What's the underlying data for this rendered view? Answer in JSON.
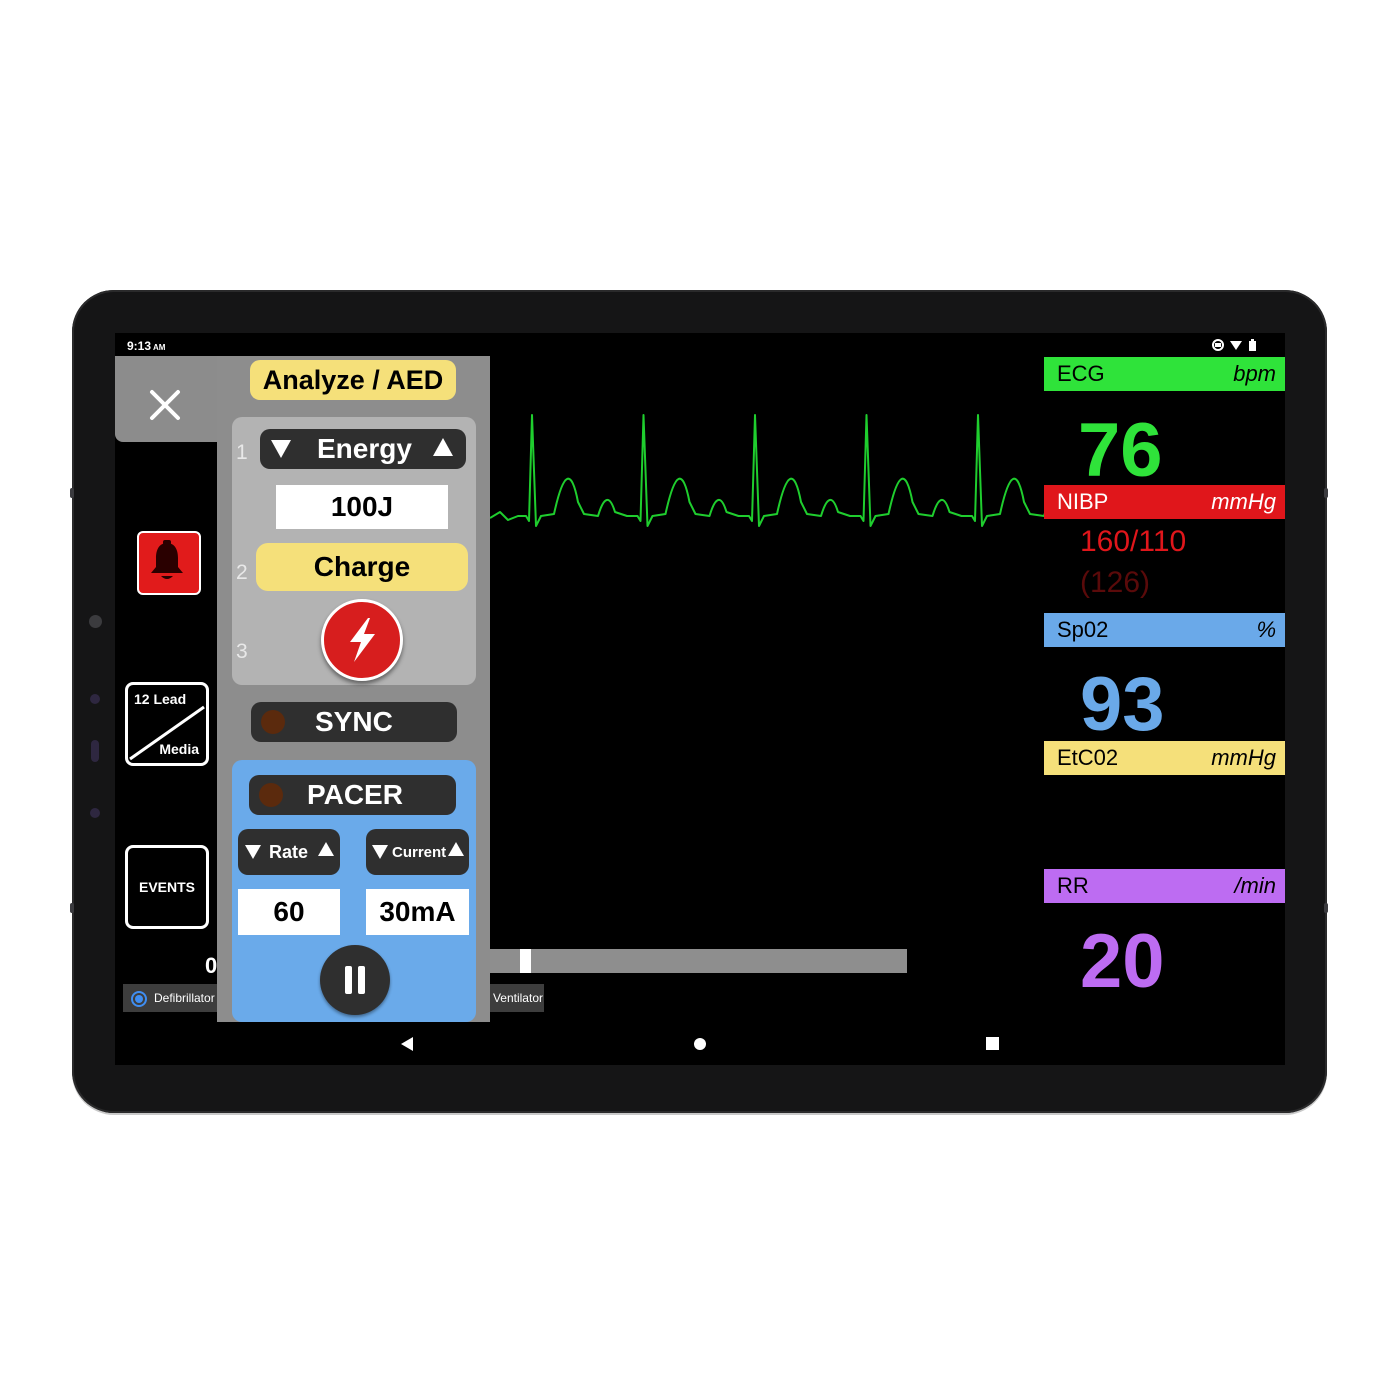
{
  "status": {
    "time": "9:13",
    "ampm": "AM"
  },
  "panel": {
    "analyze_label": "Analyze / AED",
    "step1": "1",
    "step2": "2",
    "step3": "3",
    "energy_label": "Energy",
    "energy_value": "100J",
    "charge_label": "Charge",
    "sync_label": "SYNC",
    "pacer_label": "PACER",
    "rate_label": "Rate",
    "current_label": "Current",
    "rate_value": "60",
    "current_value": "30mA"
  },
  "left_tools": {
    "lead_label": "12 Lead",
    "media_label": "Media",
    "events_label": "EVENTS"
  },
  "bottom": {
    "zero_label": "0",
    "defib_tab": "Defibrillator",
    "vent_tab": "Ventilator",
    "progress": 0.07
  },
  "vitals": {
    "ecg": {
      "label": "ECG",
      "unit": "bpm",
      "value": "76",
      "color": "#2fe33a"
    },
    "nibp": {
      "label": "NIBP",
      "unit": "mmHg",
      "value": "160/110",
      "mean": "(126)",
      "color": "#e0161b"
    },
    "spo2": {
      "label": "Sp02",
      "unit": "%",
      "value": "93",
      "color": "#6aa9e9"
    },
    "etco2": {
      "label": "EtC02",
      "unit": "mmHg",
      "color": "#f5e07a"
    },
    "rr": {
      "label": "RR",
      "unit": "/min",
      "value": "20",
      "color": "#bd6cf2"
    }
  },
  "ecg_waveform": {
    "color": "#1fce2e",
    "beats": 7
  }
}
